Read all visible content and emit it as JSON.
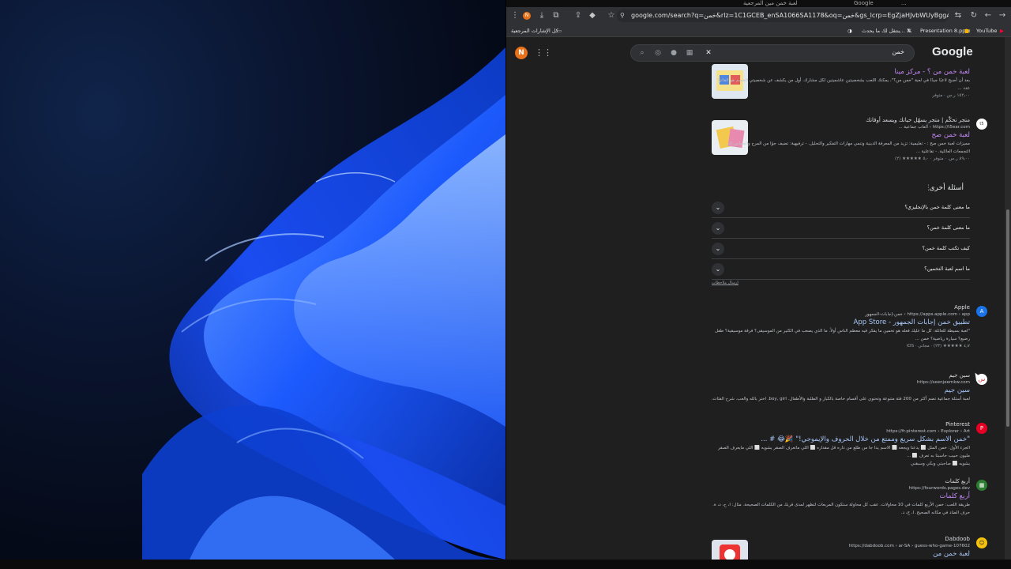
{
  "tabs": {
    "t1": "Google",
    "t2": "لعبة خمن مين المرجعية",
    "t3": "..."
  },
  "toolbar": {
    "url": "google.com/search?q=خمن&rlz=1C1GCEB_enSA1066SA1178&oq=خمن&gs_lcrp=EgZjaHJvbWUyBggAEEUYOdIBCjc3MjQ2ajBqMq..."
  },
  "bookmarks": {
    "all": "كل الإشارات المرجعية",
    "b1": "ينتقل لك ما يحدث... X",
    "b2": "Presentation 8.pptx",
    "b3": "YouTube"
  },
  "header": {
    "avatar_letter": "N",
    "query": "خمن",
    "logo": "Google"
  },
  "results": {
    "r0": {
      "title": "لعبة خمن من ؟ - مركز مينا",
      "snippet": "بعد أن أصبح لاعبًا جيدًا في لعبة \"خمن من؟\"، يمكنك اللعب بشخصيتين عاشميتين لكل مشارك. أول من يكشف عن شخصيتي الخصم هو الفائز! عدد ...",
      "meta": "١٥٢٫٠٠ ر.س · متوفر"
    },
    "r1": {
      "source": "متجر تحكّم | متجر يسهّل حياتك ويسعد أوقاتك",
      "url": "https://t5ear.com › ألعاب جماعية ...",
      "title": "لعبة خمن صح",
      "snippet": "مميزات لعبة خمن صح : - تعليمية: تزيد من المعرفة الدينية وتنمي مهارات التفكير والتحليل. - ترفيهية: تضيف جوًا من المرح والحماس إلى التجمعات العائلية. - تفاعلية ...",
      "meta": "٨٩٫٠٠ ر.س. · متوفر · ٥٫٠ ★★★★★ (٢)"
    },
    "paa_title": "أسئلة أخرى",
    "paa": [
      "ما معنى كلمة خمن بالإنجليزي؟",
      "ما معنى كلمة خمن؟",
      "كيف تكتب كلمة خمن؟",
      "ما اسم لعبة التخمين؟"
    ],
    "feedback": "إرسال ملاحظات",
    "r2": {
      "source": "Apple",
      "url": "https://apps.apple.com › app › خمن-إجابات-الجمهور",
      "title": "تطبيق خمن إجابات الجمهور - App Store",
      "snippet": "\"لعبة بسيطة للعائلة: كل ما عليك فعله هو تخمين ما يفكر فيه معظم الناس أولاً. ما الذي يصعب في الكثير من الموسيقى؟ فرقة موسيقية؟ طفل رضيع؟ سيارة رياضية؟ خمن ...",
      "meta": "٤٫٧ ★★★★★ (٢٣) · مجاني · iOS"
    },
    "r3": {
      "source": "سين جيم",
      "url": "https://seenjeemkw.com",
      "title": "سين جيم",
      "snippet": "لعبة أسئلة جماعية تضم أكثر من 200 فئة متنوعة وتحتوي على أقسام خاصة بالكبار و الطلبة والأطفال. boy, girl. اختر بالله والعب. شرح الفئات."
    },
    "r4": {
      "source": "Pinterest",
      "url": "https://fr.pinterest.com › Explorer › Art",
      "title": "\"خمن الاسم بشكل سريع وممتع من خلال الحروف والإيموجي!\" 🎉😂 # ...",
      "snippet": "الجزء الأول: خمن المثل ⬜ يدعنا ويجعه ⬜ الاسم يدا جا من طلع من داره قل مقداره ⬜ اللي ماتعرف الصقر يشويه ⬜ اللي مايعرف الصقر مليون حبيب حاسبتا به تعرف ⬜ ...",
      "snip2": "يشويه ⬜ صاحبتي وبكي وسبقني"
    },
    "r5": {
      "source": "أربع كلمات",
      "url": "https://fourwords.pages.dev",
      "title": "أربع كلمات",
      "snippet": "طريقة اللعب: خمن الأربع كلمات في 10 محاولات. عقب كل محاولة ستكون المربعات لتظهر لمدى قربك من الكلمات الصحيحة. مثال: ا، ح، د، ة.",
      "snip2": "حرف الضاد في مكانه الصحيح. ا، ج، د."
    },
    "r6": {
      "source": "Dabdoob",
      "url": "https://dabdoob.com › ar-SA › guess-who-game-107602",
      "title": "لعبة خمن من"
    }
  }
}
